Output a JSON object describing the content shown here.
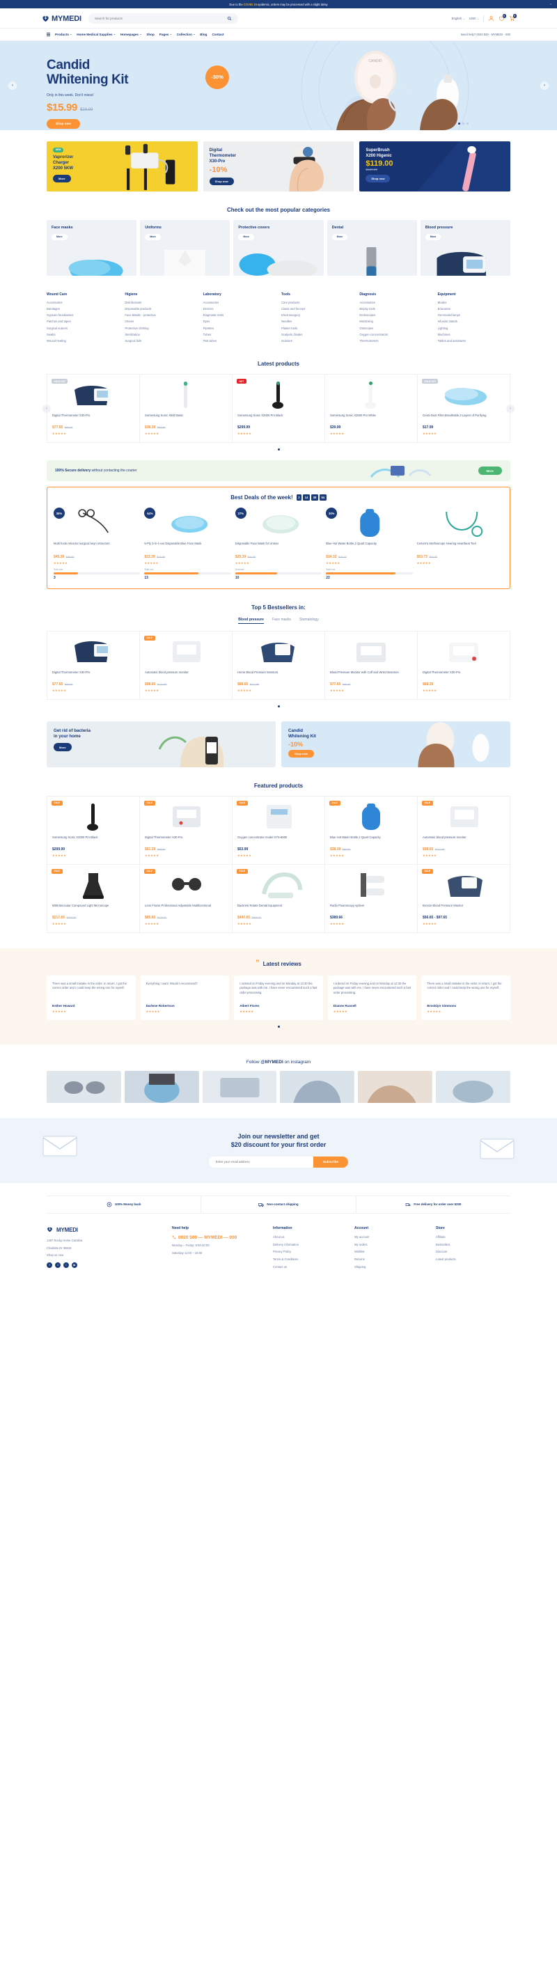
{
  "announce": {
    "prefix": "Due to the ",
    "highlight": "COVID 19",
    "suffix": " epidemic, orders may be processed with a slight delay",
    "close": "×"
  },
  "header": {
    "brand": "MYMEDI",
    "search_placeholder": "Search for products",
    "language": "English",
    "currency": "USD",
    "wishlist_count": "0",
    "cart_count": "0"
  },
  "nav": {
    "items": [
      {
        "label": "Products",
        "caret": "⌄"
      },
      {
        "label": "Home Medical Supplies",
        "caret": "⌄"
      },
      {
        "label": "Homepages",
        "caret": "⌄"
      },
      {
        "label": "Shop",
        "caret": ""
      },
      {
        "label": "Pages",
        "caret": "⌄"
      },
      {
        "label": "Collection",
        "caret": "⌄"
      },
      {
        "label": "Blog",
        "caret": ""
      },
      {
        "label": "Contact",
        "caret": ""
      }
    ],
    "help": "Need help? 0020 500 - MYMEDI - 000"
  },
  "hero": {
    "title_line1": "Candid",
    "title_line2": "Whitening Kit",
    "subtitle": "Only in this week. Don't misss!",
    "price": "$15.99",
    "old_price": "$29.99",
    "cta": "Shop now",
    "discount": "-30%",
    "prev": "‹",
    "next": "›",
    "brand_on_device": "CANDID"
  },
  "promos": [
    {
      "tag": "NEW",
      "title": "Vaprorizer\nCharger\nX200 5KW",
      "cta": "More"
    },
    {
      "title": "Digital\nThermometer\nX30-Pro",
      "discount": "-10%",
      "cta": "Shop now"
    },
    {
      "title": "SuperBrush\nX200 Higenic",
      "price": "$119.00",
      "old_price": "$129.00",
      "cta": "Shop now"
    }
  ],
  "categories": {
    "heading": "Check out the most popular categories",
    "more_label": "More",
    "items": [
      {
        "label": "Face masks"
      },
      {
        "label": "Uniforms"
      },
      {
        "label": "Protective covers"
      },
      {
        "label": "Dental"
      },
      {
        "label": "Blood pressure"
      }
    ]
  },
  "link_columns": [
    {
      "title": "Wound Care",
      "links": [
        "Accessories",
        "Bandages",
        "Gypsum foundations",
        "Patches and tapes",
        "Surgical sutures",
        "Swabs",
        "Wound healing"
      ]
    },
    {
      "title": "Higiene",
      "links": [
        "Disinfectants",
        "Disposable products",
        "Face Masks - protective",
        "Gloves",
        "Protective clothing",
        "Sterilization",
        "Surgical foils"
      ]
    },
    {
      "title": "Laboratory",
      "links": [
        "Accessories",
        "Devices",
        "Diagnostic tests",
        "Dyes",
        "Pipettes",
        "Tubes",
        "Test-tubes"
      ]
    },
    {
      "title": "Tools",
      "links": [
        "Care products",
        "Claws and forceps",
        "Electrosurgery",
        "Needles",
        "Plaster tools",
        "Scalpels, blades",
        "Scissors"
      ]
    },
    {
      "title": "Diagnosis",
      "links": [
        "Accessories",
        "Biopsy tools",
        "Endoscopes",
        "Monitoring",
        "Otoscopes",
        "Oxygen concentrators",
        "Thermometers"
      ]
    },
    {
      "title": "Equipment",
      "links": [
        "Blades",
        "Education",
        "Germicidal lamps",
        "Infusion stands",
        "Lighting",
        "Machines",
        "Tables and assistants"
      ]
    }
  ],
  "latest": {
    "title": "Latest products",
    "prev": "‹",
    "next": "›",
    "products": [
      {
        "flag": "SOLD OUT",
        "flag_type": "sold",
        "name": "Digital Thermometer X30-Pro",
        "price": "$77.65",
        "old": "$80.65",
        "stars": "★★★★★"
      },
      {
        "flag": "",
        "flag_type": "",
        "name": "Somersung Sonic X500 Basic",
        "price": "$38.39",
        "old": "$53.99",
        "stars": "★★★★★"
      },
      {
        "flag": "HOT",
        "flag_type": "hot",
        "name": "Somersung Sonic X2000 Pro Black",
        "price": "$299.99",
        "old": "",
        "stars": "★★★★★"
      },
      {
        "flag": "",
        "flag_type": "",
        "name": "Somersung Sonic X2500 Pro White",
        "price": "$39.99",
        "old": "",
        "stars": "★★★★★"
      },
      {
        "flag": "SOLD OUT",
        "flag_type": "sold",
        "name": "GAnti-Dust Filter,Breathable,3 Layers of Purifying",
        "price": "$17.99",
        "old": "",
        "stars": "★★★★★"
      }
    ]
  },
  "strip": {
    "bold": "100% Secure delivery",
    "rest": " without contacting the courier",
    "cta": "More"
  },
  "deals": {
    "title": "Best Deals of the week!",
    "timer": [
      "2",
      "14",
      "38",
      "54"
    ],
    "sold_label": "Sold out:",
    "items": [
      {
        "badge": "35%",
        "name": "Multi hook retractor surgical laryn retractors",
        "price": "$45.39",
        "old": "$69.99",
        "sold": "3",
        "pct": 28,
        "stars": "★★★★★"
      },
      {
        "badge": "54%",
        "name": "5-Ply 3-in-1-ear Disposable Blue Face Mask",
        "price": "$22.39",
        "old": "$43.99",
        "sold": "13",
        "pct": 62,
        "stars": "★★★★★"
      },
      {
        "badge": "37%",
        "name": "Disposable Face Mask for Unisex",
        "price": "$20.39",
        "old": "$31.99",
        "sold": "10",
        "pct": 48,
        "stars": "★★★★★"
      },
      {
        "badge": "30%",
        "name": "Blue Hot Water Bottle,2 Quart Capacity",
        "price": "$14.32",
        "old": "$16.32",
        "sold": "22",
        "pct": 80,
        "stars": "★★★★★"
      },
      {
        "badge": "",
        "name": "Cemen's Stethoscope Hearing Heartbeat Tool",
        "price": "$53.73",
        "old": "$64.55",
        "sold": "",
        "pct": 0,
        "stars": "★★★★★"
      }
    ]
  },
  "bestsellers": {
    "title": "Top 5 Bestsellers in:",
    "tabs": [
      {
        "label": "Blood pressure",
        "active": true
      },
      {
        "label": "Face masks",
        "active": false
      },
      {
        "label": "Stomatology",
        "active": false
      }
    ],
    "products": [
      {
        "flag": "",
        "name": "Digital Thermometer X30-Pro",
        "price": "$77.65",
        "old": "$80.65",
        "stars": "★★★★★"
      },
      {
        "flag": "SALE",
        "name": "Automatic blood pressure monitor",
        "price": "$98.65",
        "old": "$127.65",
        "stars": "★★★★★"
      },
      {
        "flag": "",
        "name": "Home Blood Pressure Monitors",
        "price": "$88.65",
        "old": "$117.65",
        "stars": "★★★★★"
      },
      {
        "flag": "",
        "name": "Blood Pressure Monitor with Cuff and Wrist Detection",
        "price": "$77.65",
        "old": "$88.65",
        "stars": "★★★★★"
      },
      {
        "flag": "",
        "name": "Digital Thermometer X30-Pro",
        "price": "$68.39",
        "old": "",
        "stars": "★★★★★"
      }
    ]
  },
  "banners": [
    {
      "title": "Get rid of bacteria\nin your home",
      "cta": "More"
    },
    {
      "title": "Candid\nWhitening Kit",
      "discount": "-10%",
      "cta": "Shop now"
    }
  ],
  "featured": {
    "title": "Featured products",
    "products": [
      {
        "flag": "SALE",
        "name": "Somersung Sonic X2000 Pro Black",
        "price": "$299.99",
        "old": "",
        "stars": "★★★★★"
      },
      {
        "flag": "SALE",
        "name": "Digital Thermometer X30-Pro",
        "price": "$61.39",
        "old": "$89.99",
        "stars": "★★★★★"
      },
      {
        "flag": "SALE",
        "name": "Oxygen concentrator model XY5-8000",
        "price": "$53.99",
        "old": "",
        "stars": "★★★★★"
      },
      {
        "flag": "SALE",
        "name": "Blue Hot Water Bottle,2 Quart Capacity",
        "price": "$38.39",
        "old": "$53.99",
        "stars": "★★★★★"
      },
      {
        "flag": "SALE",
        "name": "Automatic blood pressure monitor",
        "price": "$98.65",
        "old": "$127.65",
        "stars": "★★★★★"
      },
      {
        "flag": "SALE",
        "name": "M58 Binocular Compound Light Microscope",
        "price": "$217.65",
        "old": "$318.65",
        "stars": "★★★★★"
      },
      {
        "flag": "SALE",
        "name": "Lens Frame Professional Adjustable Multifunctional",
        "price": "$85.65",
        "old": "$118.65",
        "stars": "★★★★★"
      },
      {
        "flag": "SALE",
        "name": "Backrest Rotate Dental Equipment",
        "price": "$497.65",
        "old": "$568.65",
        "stars": "★★★★★"
      },
      {
        "flag": "",
        "name": "Radio Fluoroscopy system",
        "price": "$389.66",
        "old": "",
        "stars": "★★★★★"
      },
      {
        "flag": "SALE",
        "name": "Bronze Blood Pressure Monitor",
        "price": "$56.65 - $97.65",
        "old": "",
        "stars": "★★★★★"
      }
    ]
  },
  "reviews": {
    "title": "Latest reviews",
    "items": [
      {
        "text": "There was a small mistake in the order. In return, I got the correct order and I could keep the wrong one for myself.",
        "who": "Esther Howard",
        "stars": "★★★★★"
      },
      {
        "text": "Everything I want. Would I recommend?",
        "who": "Darlene Robertson",
        "stars": "★★★★★"
      },
      {
        "text": "I ordered on Friday evening and on Monday at 12:30 the package was with me. I have never encountered such a fast order processing.",
        "who": "Albert Flores",
        "stars": "★★★★★"
      },
      {
        "text": "I ordered on Friday evening and on Monday at 12:30 the package was with me. I have never encountered such a fast order processing.",
        "who": "Dianne Russell",
        "stars": "★★★★★"
      },
      {
        "text": "There was a small mistake in the order. In return, I got the correct order and I could keep the wrong one for myself.",
        "who": "Brooklyn Simmons",
        "stars": "★★★★★"
      }
    ]
  },
  "instagram": {
    "prefix": "Follow ",
    "handle": "@MYMEDI",
    "suffix": " on instagram"
  },
  "newsletter": {
    "line1": "Join our newsletter and get",
    "line2": "$20 discount for your first order",
    "placeholder": "Enter your email address",
    "cta": "Subscribe"
  },
  "trust": [
    {
      "icon": "money-back-icon",
      "label": "100% Money back"
    },
    {
      "icon": "shipping-icon",
      "label": "Non-contact shipping"
    },
    {
      "icon": "delivery-icon",
      "label": "Free delivery for order over $200"
    }
  ],
  "footer": {
    "brand": "MYMEDI",
    "address1": "1487 Rocky Horse Carolina",
    "address2": "Charlotte Dr 36919",
    "email": "Shop us now",
    "help_title": "Need help",
    "phone": "0020 500 — MYMEDI — 000",
    "hours1": "Monday – Friday: 9:00-20:00",
    "hours2": "Saturday 11:00 – 15:00",
    "columns": [
      {
        "title": "Information",
        "links": [
          "About us",
          "Delivery information",
          "Privacy Policy",
          "Terms & Conditions",
          "Contact us"
        ]
      },
      {
        "title": "Account",
        "links": [
          "My account",
          "My orders",
          "Wishlist",
          "Returns",
          "Shipping"
        ]
      },
      {
        "title": "Store",
        "links": [
          "Affiliate",
          "Bestsellers",
          "Discount",
          "Latest products"
        ]
      }
    ]
  },
  "colors": {
    "navy": "#1b3a78",
    "orange": "#fb9233",
    "yellow": "#f5cf2e",
    "green": "#4cb572",
    "light_blue": "#d7e8f7"
  }
}
